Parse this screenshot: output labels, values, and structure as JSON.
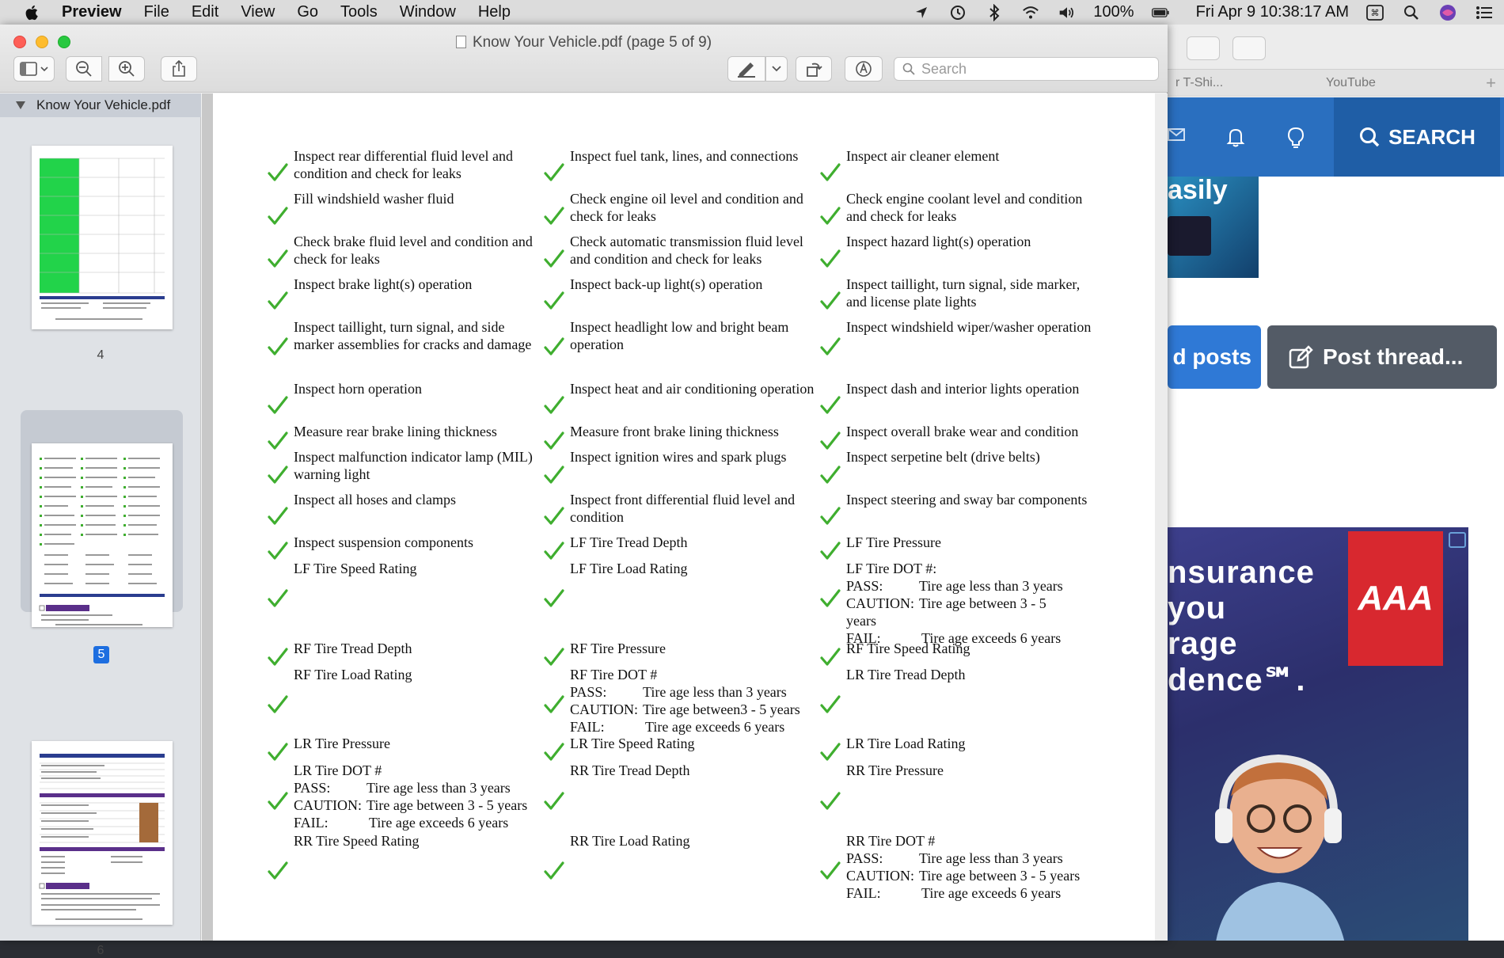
{
  "menubar": {
    "app": "Preview",
    "items": [
      "File",
      "Edit",
      "View",
      "Go",
      "Tools",
      "Window",
      "Help"
    ],
    "battery": "100%",
    "datetime": "Fri Apr 9  10:38:17 AM"
  },
  "window": {
    "title": "Know Your Vehicle.pdf (page 5 of 9)",
    "search_placeholder": "Search"
  },
  "sidebar": {
    "doc_name": "Know Your Vehicle.pdf",
    "pages": [
      "4",
      "5",
      "6"
    ],
    "selected": "5"
  },
  "browser": {
    "tab1": "r T-Shi...",
    "tab2": "YouTube",
    "search_label": "SEARCH",
    "promo_text": "asily",
    "posts_label": "d posts",
    "post_thread_label": "Post thread...",
    "ad_lines": [
      "nsurance",
      "you",
      "rage",
      "dence℠."
    ],
    "ad_brand": "AAA"
  },
  "checklist": [
    [
      "Inspect rear differential fluid level and condition and check for leaks",
      "Inspect fuel tank, lines, and connections",
      "Inspect air cleaner element"
    ],
    [
      "Fill windshield washer fluid",
      "Check engine oil level and condition and check for leaks",
      "Check engine coolant level and condition and check for leaks"
    ],
    [
      "Check brake fluid level and condition and check for leaks",
      "Check automatic transmission fluid level and condition and check for leaks",
      "Inspect  hazard light(s) operation"
    ],
    [
      "Inspect brake light(s) operation",
      "Inspect  back-up light(s) operation",
      "Inspect taillight, turn signal, side marker, and license plate lights"
    ],
    [
      "Inspect taillight, turn signal, and side marker assemblies for cracks and damage",
      "Inspect  headlight low and bright beam operation",
      "Inspect windshield wiper/washer operation"
    ],
    [
      "Inspect horn operation",
      "Inspect heat and air conditioning operation",
      "Inspect dash and interior lights operation"
    ],
    [
      "Measure rear brake lining thickness",
      "Measure front brake lining thickness",
      "Inspect overall brake wear and condition"
    ],
    [
      "Inspect malfunction indicator lamp (MIL) warning light",
      "Inspect ignition wires and spark plugs",
      "Inspect serpetine belt (drive belts)"
    ],
    [
      "Inspect all hoses and clamps",
      "Inspect front differential fluid level and condition",
      "Inspect steering and sway bar components"
    ],
    [
      "Inspect suspension components",
      "LF Tire Tread Depth",
      "LF Tire Pressure"
    ]
  ],
  "tires": {
    "lf_speed": "LF Tire Speed Rating",
    "lf_load": "LF Tire Load Rating",
    "lf_dot": "LF Tire DOT #:",
    "rf_tread": "RF Tire Tread Depth",
    "rf_pressure": "RF Tire Pressure",
    "rf_speed": "RF Tire Speed Rating",
    "rf_load": "RF Tire Load Rating",
    "rf_dot": "RF Tire DOT #",
    "lr_tread": "LR Tire Tread Depth",
    "lr_pressure": "LR Tire Pressure",
    "lr_speed": "LR Tire Speed Rating",
    "lr_load": "LR Tire Load Rating",
    "lr_dot": "LR Tire DOT #",
    "rr_tread": "RR Tire Tread Depth",
    "rr_pressure": "RR Tire Pressure",
    "rr_speed": "RR Tire Speed Rating",
    "rr_load": "RR Tire Load Rating",
    "rr_dot": "RR Tire DOT #",
    "pass": "PASS:",
    "caution": "CAUTION:",
    "fail": "FAIL:",
    "pass_text": "Tire age less than 3 years",
    "caution_text": "Tire age between 3 - 5 years",
    "caution_text_lf": "Tire age between 3 - 5",
    "caution_text_lf2": "years",
    "caution_text_rf": "Tire age between3 - 5 years",
    "fail_text": "Tire age exceeds 6 years"
  },
  "colors": {
    "check": "#3fae2f",
    "select_blue": "#1d6ee0"
  }
}
